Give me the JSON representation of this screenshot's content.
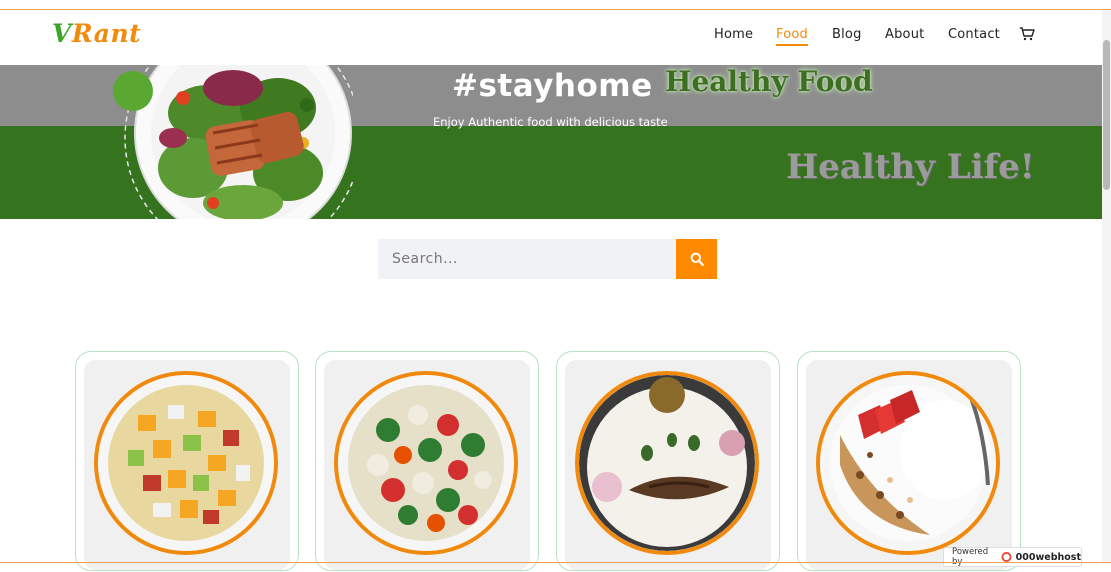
{
  "brand": {
    "logo_part1": "V",
    "logo_part2": "Rant"
  },
  "nav": {
    "items": [
      {
        "label": "Home",
        "active": false
      },
      {
        "label": "Food",
        "active": true
      },
      {
        "label": "Blog",
        "active": false
      },
      {
        "label": "About",
        "active": false
      },
      {
        "label": "Contact",
        "active": false
      }
    ],
    "cart_icon": "cart-icon"
  },
  "hero": {
    "title": "#stayhome",
    "healthy_food": "Healthy Food",
    "subtitle": "Enjoy Authentic food with delicious taste",
    "healthy_life": "Healthy Life!"
  },
  "search": {
    "placeholder": "Search...",
    "button_icon": "search-icon"
  },
  "dishes": [
    {
      "name": "fruit-salad",
      "icon": "fruit-salad-bowl"
    },
    {
      "name": "vegetable-salad",
      "icon": "vegetable-bowl"
    },
    {
      "name": "rice-and-fish",
      "icon": "rice-fish-plate"
    },
    {
      "name": "granola-and-yogurt",
      "icon": "granola-yogurt-bowl"
    }
  ],
  "badge": {
    "prefix": "Powered by",
    "brand": "000webhost"
  },
  "colors": {
    "accent": "#f28a0e",
    "green": "#35731f",
    "logo_green": "#3ba629",
    "grey_band": "#8d8d8d"
  }
}
